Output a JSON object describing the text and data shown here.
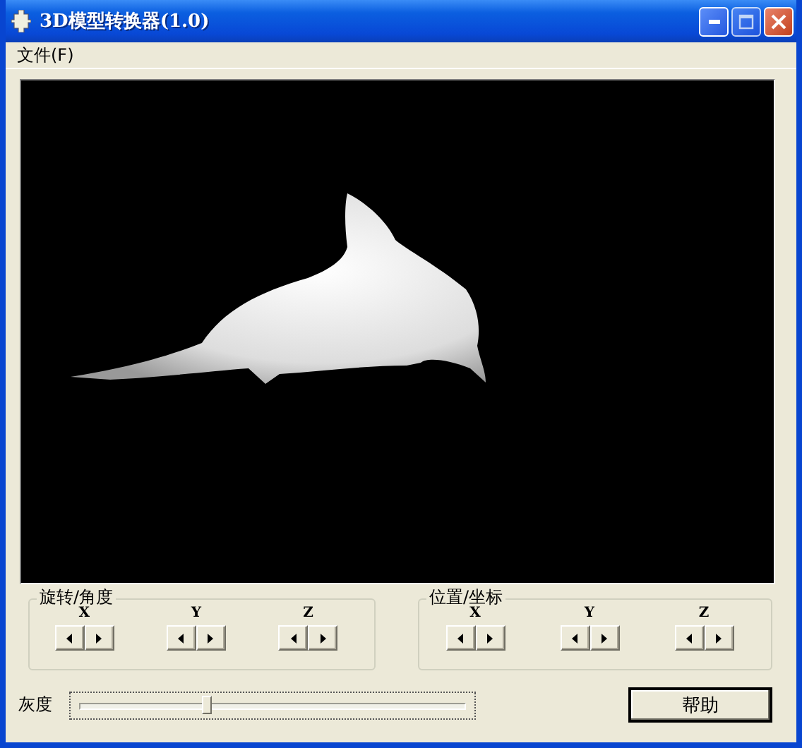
{
  "window": {
    "title": "3D模型转换器(1.0)"
  },
  "menu": [
    {
      "label": "文件(F)"
    }
  ],
  "rotation_group": {
    "title": "旋转/角度",
    "axes": [
      {
        "label": "X"
      },
      {
        "label": "Y"
      },
      {
        "label": "Z"
      }
    ]
  },
  "position_group": {
    "title": "位置/坐标",
    "axes": [
      {
        "label": "X"
      },
      {
        "label": "Y"
      },
      {
        "label": "Z"
      }
    ]
  },
  "gray_slider": {
    "label": "灰度",
    "level": 0.33
  },
  "help_button": {
    "label": "帮助"
  }
}
